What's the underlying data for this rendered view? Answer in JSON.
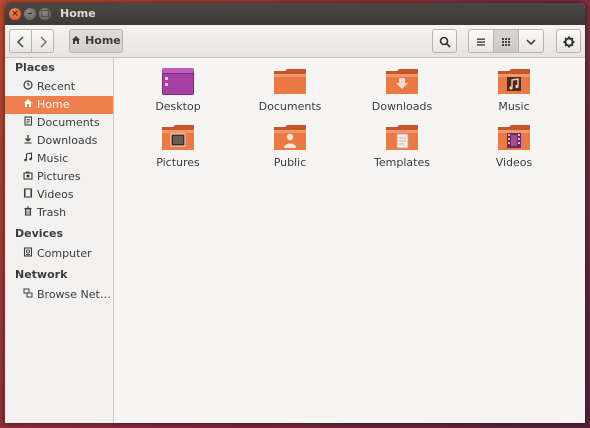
{
  "window": {
    "title": "Home"
  },
  "toolbar": {
    "back_icon": "chevron-left",
    "forward_icon": "chevron-right",
    "path_button_label": "Home",
    "search_icon": "search",
    "list_view_icon": "list",
    "grid_view_icon": "grid",
    "more_icon": "chevron-down",
    "gear_icon": "gear"
  },
  "sidebar": {
    "sections": [
      {
        "label": "Places",
        "items": [
          {
            "label": "Recent",
            "icon": "clock",
            "active": false
          },
          {
            "label": "Home",
            "icon": "home",
            "active": true
          },
          {
            "label": "Documents",
            "icon": "document",
            "active": false
          },
          {
            "label": "Downloads",
            "icon": "download",
            "active": false
          },
          {
            "label": "Music",
            "icon": "music",
            "active": false
          },
          {
            "label": "Pictures",
            "icon": "camera",
            "active": false
          },
          {
            "label": "Videos",
            "icon": "film",
            "active": false
          },
          {
            "label": "Trash",
            "icon": "trash",
            "active": false
          }
        ]
      },
      {
        "label": "Devices",
        "items": [
          {
            "label": "Computer",
            "icon": "drive",
            "active": false
          }
        ]
      },
      {
        "label": "Network",
        "items": [
          {
            "label": "Browse Net…",
            "icon": "network",
            "active": false
          }
        ]
      }
    ]
  },
  "files": [
    {
      "label": "Desktop",
      "icon": "desktop-folder"
    },
    {
      "label": "Documents",
      "icon": "folder"
    },
    {
      "label": "Downloads",
      "icon": "download-folder"
    },
    {
      "label": "Music",
      "icon": "music-folder"
    },
    {
      "label": "Pictures",
      "icon": "pictures-folder"
    },
    {
      "label": "Public",
      "icon": "public-folder"
    },
    {
      "label": "Templates",
      "icon": "templates-folder"
    },
    {
      "label": "Videos",
      "icon": "videos-folder"
    }
  ],
  "colors": {
    "accent": "#ef7f4c",
    "folder": "#e9753f",
    "titlebar": "#3c3b37"
  }
}
